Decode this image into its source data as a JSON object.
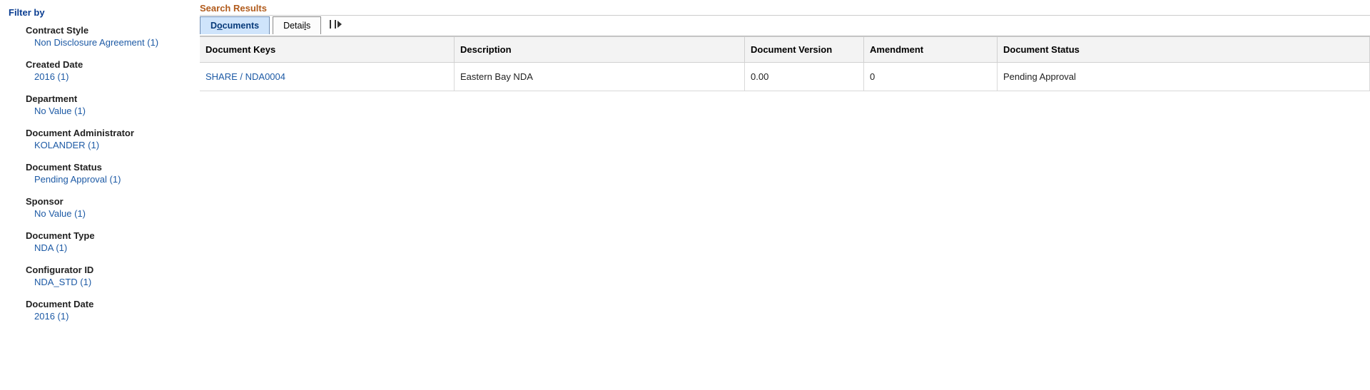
{
  "sidebar": {
    "title": "Filter by",
    "facets": [
      {
        "label": "Contract Style",
        "value": "Non Disclosure Agreement (1)"
      },
      {
        "label": "Created Date",
        "value": "2016 (1)"
      },
      {
        "label": "Department",
        "value": "No Value (1)"
      },
      {
        "label": "Document Administrator",
        "value": "KOLANDER (1)"
      },
      {
        "label": "Document Status",
        "value": "Pending Approval (1)"
      },
      {
        "label": "Sponsor",
        "value": "No Value (1)"
      },
      {
        "label": "Document Type",
        "value": "NDA (1)"
      },
      {
        "label": "Configurator ID",
        "value": "NDA_STD (1)"
      },
      {
        "label": "Document Date",
        "value": "2016 (1)"
      }
    ]
  },
  "main": {
    "title": "Search Results",
    "tabs": [
      {
        "label": "Documents",
        "active": true,
        "underline_at": 1
      },
      {
        "label": "Details",
        "active": false,
        "underline_at": 5
      }
    ],
    "columns": [
      "Document Keys",
      "Description",
      "Document Version",
      "Amendment",
      "Document Status"
    ],
    "rows": [
      {
        "keys": "SHARE / NDA0004",
        "desc": "Eastern Bay NDA",
        "version": "0.00",
        "amendment": "0",
        "status": "Pending Approval"
      }
    ]
  }
}
